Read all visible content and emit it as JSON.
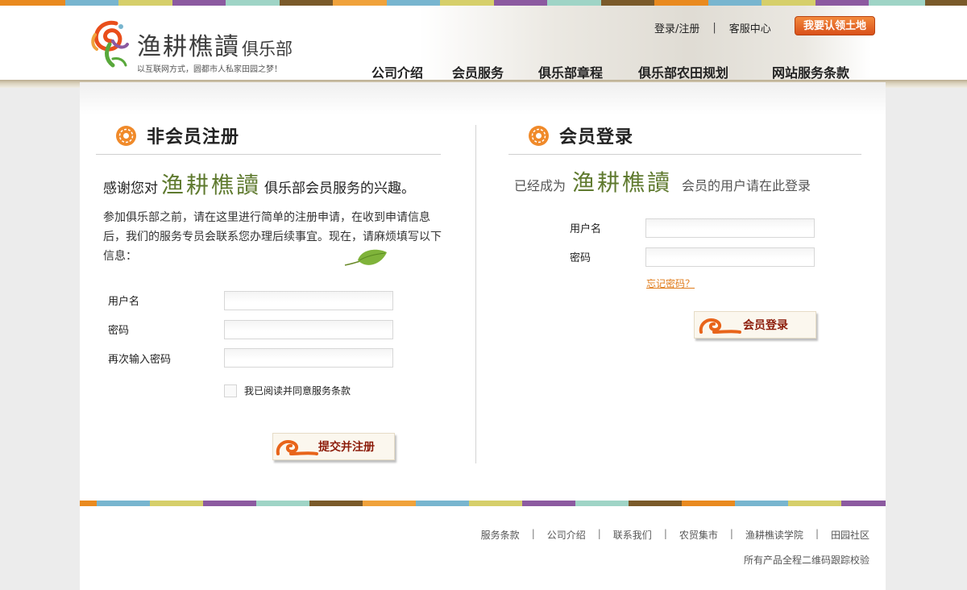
{
  "colors": {
    "stripe": [
      "#e98a1f",
      "#78b5cf",
      "#d6cf6a",
      "#8c5aa0",
      "#9fd4c6",
      "#7a5a2a",
      "#f0a23b",
      "#78b5cf",
      "#d6cf6a",
      "#8c5aa0",
      "#9fd4c6",
      "#7a5a2a",
      "#e98a1f",
      "#78b5cf",
      "#d6cf6a",
      "#8c5aa0",
      "#9fd4c6",
      "#7a5a2a"
    ],
    "brand_green": "#5f7a2f",
    "accent_orange": "#e07b1a"
  },
  "header": {
    "logo_title": "渔耕樵讀",
    "logo_title_small": "俱乐部",
    "logo_slogan": "以互联网方式，圆都市人私家田园之梦！",
    "login_register": "登录/注册",
    "separator": "|",
    "customer_service": "客服中心",
    "claim_land_button": "我要认领土地"
  },
  "nav": {
    "items": [
      "公司介绍",
      "会员服务",
      "俱乐部章程",
      "俱乐部农田规划",
      "网站服务条款"
    ]
  },
  "register": {
    "section_title": "非会员注册",
    "intro_prefix": "感谢您对",
    "brand": "渔耕樵讀",
    "intro_suffix": "俱乐部会员服务的兴趣。",
    "paragraph": "参加俱乐部之前，请在这里进行简单的注册申请，在收到申请信息后，我们的服务专员会联系您办理后续事宜。现在，请麻烦填写以下信息：",
    "username_label": "用户名",
    "password_label": "密码",
    "confirm_label": "再次输入密码",
    "username_value": "",
    "password_value": "",
    "confirm_value": "",
    "agree_label": "我已阅读并同意服务条款",
    "submit_button": "提交并注册"
  },
  "login": {
    "section_title": "会员登录",
    "lead_prefix": "已经成为",
    "brand": "渔耕樵讀",
    "lead_suffix": "会员的用户请在此登录",
    "username_label": "用户名",
    "password_label": "密码",
    "username_value": "",
    "password_value": "",
    "forgot_link": "忘记密码？",
    "login_button": "会员登录"
  },
  "footer": {
    "links": [
      "服务条款",
      "公司介绍",
      "联系我们",
      "农贸集市",
      "渔耕樵读学院",
      "田园社区"
    ],
    "note": "所有产品全程二维码跟踪校验"
  }
}
